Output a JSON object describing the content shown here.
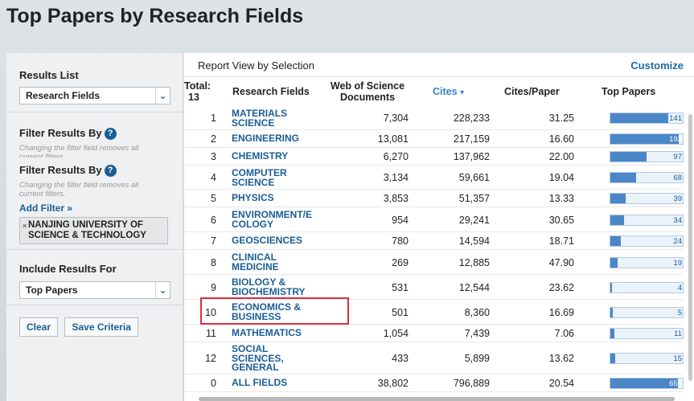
{
  "page": {
    "title": "Top Papers by Research Fields"
  },
  "sidebar": {
    "results_list_label": "Results List",
    "results_list_value": "Research Fields",
    "filter_label_1": "Filter Results By",
    "filter_hint_1a": "Changing the filter field removes all",
    "filter_hint_1b": "current filters.",
    "filter_label_2": "Filter Results By",
    "filter_hint_2a": "Changing the filter field removes all",
    "filter_hint_2b": "current filters.",
    "add_filter": "Add Filter »",
    "filter_chip_line1": "NANJING UNIVERSITY OF",
    "filter_chip_line2": "SCIENCE & TECHNOLOGY",
    "filter_chip_remove": "×",
    "include_label": "Include Results For",
    "include_value": "Top Papers",
    "help_glyph": "?",
    "chevron_glyph": "⌄",
    "clear_button": "Clear",
    "save_button": "Save Criteria"
  },
  "main": {
    "report_view": "Report View by Selection",
    "customize": "Customize",
    "total_label": "Total:",
    "total_value": "13",
    "columns": {
      "field": "Research Fields",
      "wos_docs_1": "Web of Science",
      "wos_docs_2": "Documents",
      "cites": "Cites",
      "cites_sort_glyph": "▾",
      "cites_per_paper": "Cites/Paper",
      "top_papers": "Top Papers"
    },
    "rows": [
      {
        "rank": "1",
        "field": [
          "MATERIALS",
          "SCIENCE"
        ],
        "docs": "7,304",
        "cites": "228,233",
        "cpp": "31.25",
        "top": "141",
        "fill": 0.8
      },
      {
        "rank": "2",
        "field": [
          "ENGINEERING"
        ],
        "docs": "13,081",
        "cites": "217,159",
        "cpp": "16.60",
        "top": "193",
        "fill": 0.94
      },
      {
        "rank": "3",
        "field": [
          "CHEMISTRY"
        ],
        "docs": "6,270",
        "cites": "137,962",
        "cpp": "22.00",
        "top": "97",
        "fill": 0.5
      },
      {
        "rank": "4",
        "field": [
          "COMPUTER",
          "SCIENCE"
        ],
        "docs": "3,134",
        "cites": "59,661",
        "cpp": "19.04",
        "top": "68",
        "fill": 0.35
      },
      {
        "rank": "5",
        "field": [
          "PHYSICS"
        ],
        "docs": "3,853",
        "cites": "51,357",
        "cpp": "13.33",
        "top": "39",
        "fill": 0.21
      },
      {
        "rank": "6",
        "field": [
          "ENVIRONMENT/E",
          "COLOGY"
        ],
        "docs": "954",
        "cites": "29,241",
        "cpp": "30.65",
        "top": "34",
        "fill": 0.19
      },
      {
        "rank": "7",
        "field": [
          "GEOSCIENCES"
        ],
        "docs": "780",
        "cites": "14,594",
        "cpp": "18.71",
        "top": "24",
        "fill": 0.14
      },
      {
        "rank": "8",
        "field": [
          "CLINICAL",
          "MEDICINE"
        ],
        "docs": "269",
        "cites": "12,885",
        "cpp": "47.90",
        "top": "19",
        "fill": 0.1
      },
      {
        "rank": "9",
        "field": [
          "BIOLOGY &",
          "BIOCHEMISTRY"
        ],
        "docs": "531",
        "cites": "12,544",
        "cpp": "23.62",
        "top": "4",
        "fill": 0.02
      },
      {
        "rank": "10",
        "field": [
          "ECONOMICS &",
          "BUSINESS"
        ],
        "docs": "501",
        "cites": "8,360",
        "cpp": "16.69",
        "top": "5",
        "fill": 0.03
      },
      {
        "rank": "11",
        "field": [
          "MATHEMATICS"
        ],
        "docs": "1,054",
        "cites": "7,439",
        "cpp": "7.06",
        "top": "11",
        "fill": 0.05
      },
      {
        "rank": "12",
        "field": [
          "SOCIAL",
          "SCIENCES,",
          "GENERAL"
        ],
        "docs": "433",
        "cites": "5,899",
        "cpp": "13.62",
        "top": "15",
        "fill": 0.07
      },
      {
        "rank": "0",
        "field": [
          "ALL FIELDS"
        ],
        "docs": "38,802",
        "cites": "796,889",
        "cpp": "20.54",
        "top": "655",
        "fill": 0.93
      }
    ]
  },
  "colors": {
    "link": "#1a5d95",
    "bar": "#4a86c8",
    "highlight": "#d9303e"
  }
}
